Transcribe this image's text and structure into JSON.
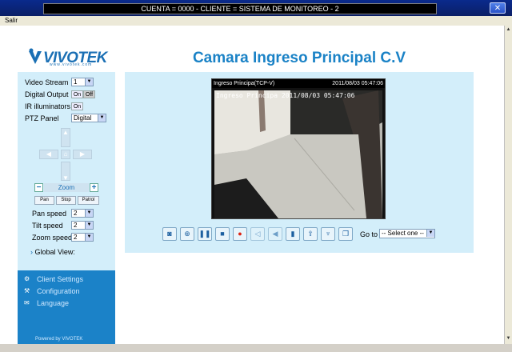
{
  "window": {
    "title": "CUENTA = 0000 - CLIENTE = SISTEMA DE MONITOREO - 2",
    "menu_exit": "Salir",
    "close_glyph": "✕"
  },
  "logo": {
    "text": "VIVOTEK",
    "sub": "www.vivotek.com"
  },
  "page_title": "Camara Ingreso Principal C.V",
  "controls": {
    "video_stream_label": "Video Stream",
    "video_stream_value": "1",
    "digital_output_label": "Digital Output",
    "digital_on": "On",
    "digital_off": "Off",
    "ir_label": "IR illuminators",
    "ir_on": "On",
    "ptz_label": "PTZ Panel",
    "ptz_value": "Digital",
    "zoom_label": "Zoom",
    "zoom_minus": "−",
    "zoom_plus": "+",
    "pan_label": "Pan",
    "stop_label": "Stop",
    "patrol_label": "Patrol",
    "pan_speed_label": "Pan speed",
    "pan_speed_value": "2",
    "tilt_speed_label": "Tilt speed",
    "tilt_speed_value": "2",
    "zoom_speed_label": "Zoom speed",
    "zoom_speed_value": "2",
    "global_view_label": "Global View:"
  },
  "nav": {
    "client_settings": "Client Settings",
    "configuration": "Configuration",
    "language": "Language",
    "powered_by": "Powered by VIVOTEK"
  },
  "video": {
    "header_left": "Ingreso Principa(TCP-V)",
    "header_right": "2011/08/03 05:47:06",
    "osd_text": "Ingreso Principa 2011/08/03 05:47:06"
  },
  "toolbar": {
    "goto_label": "Go to",
    "goto_value": "-- Select one --",
    "icons": [
      "camera-icon",
      "zoom-icon",
      "pause-icon",
      "stop-icon",
      "record-icon",
      "mute-icon",
      "volume-icon",
      "save-icon",
      "upload-icon",
      "mic-icon",
      "fullscreen-icon"
    ]
  },
  "colors": {
    "accent": "#1a82c6",
    "panel": "#d3eefa",
    "sidebar_bottom": "#1b82c8"
  }
}
